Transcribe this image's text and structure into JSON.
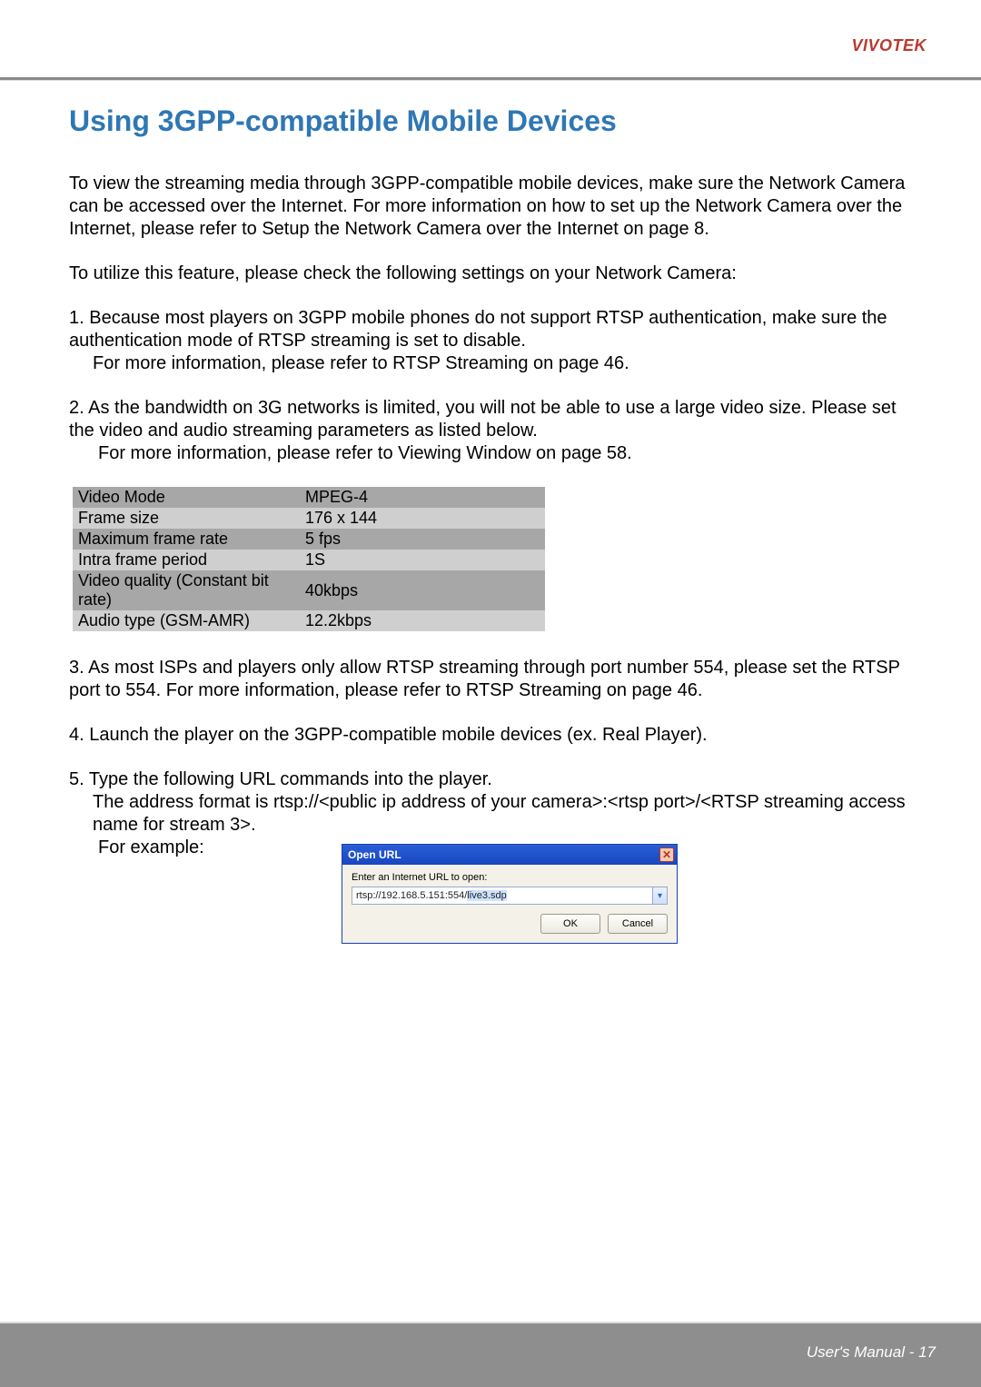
{
  "brand": "VIVOTEK",
  "title": "Using 3GPP-compatible Mobile Devices",
  "paragraphs": {
    "p1": "To view the streaming media through 3GPP-compatible mobile devices, make sure the Network Camera can be accessed over the Internet. For more information on how to set up the Network Camera over the Internet, please refer to Setup the Network Camera over the Internet on page 8.",
    "p2": "To utilize this feature, please check the following settings on your Network Camera:"
  },
  "list": {
    "i1": {
      "num": "1.",
      "line1": "Because most players on 3GPP mobile phones do not support RTSP authentication, make sure the authentication mode of RTSP streaming is set to disable.",
      "line2": "For more information, please refer to RTSP Streaming on page 46."
    },
    "i2": {
      "num": "2.",
      "line1": "As the bandwidth on 3G networks is limited, you will not be able to use a large video size. Please set the video and audio streaming parameters as listed below.",
      "line2": "For more information, please refer to Viewing Window on page 58."
    },
    "i3": {
      "num": "3.",
      "line1": "As most ISPs and players only allow RTSP streaming through port number 554, please set the RTSP port to 554. For more information, please refer to RTSP Streaming on page 46."
    },
    "i4": {
      "num": "4.",
      "line1": "Launch the player on the 3GPP-compatible mobile devices (ex. Real Player)."
    },
    "i5": {
      "num": "5.",
      "line1": "Type the following URL commands into the player.",
      "line2": "The address format is rtsp://<public ip address of your camera>:<rtsp port>/<RTSP streaming access name for stream 3>.",
      "line3": "For example:"
    }
  },
  "settings": [
    {
      "k": "Video Mode",
      "v": "MPEG-4"
    },
    {
      "k": "Frame size",
      "v": "176 x 144"
    },
    {
      "k": "Maximum frame rate",
      "v": "5 fps"
    },
    {
      "k": "Intra frame period",
      "v": "1S"
    },
    {
      "k": "Video quality (Constant bit rate)",
      "v": "40kbps"
    },
    {
      "k": "Audio type (GSM-AMR)",
      "v": "12.2kbps"
    }
  ],
  "dialog": {
    "title": "Open URL",
    "label": "Enter an Internet URL to open:",
    "url_prefix": "rtsp://192.168.5.151:554/",
    "url_selected": "live3.sdp",
    "ok": "OK",
    "cancel": "Cancel"
  },
  "footer": "User's Manual - 17"
}
